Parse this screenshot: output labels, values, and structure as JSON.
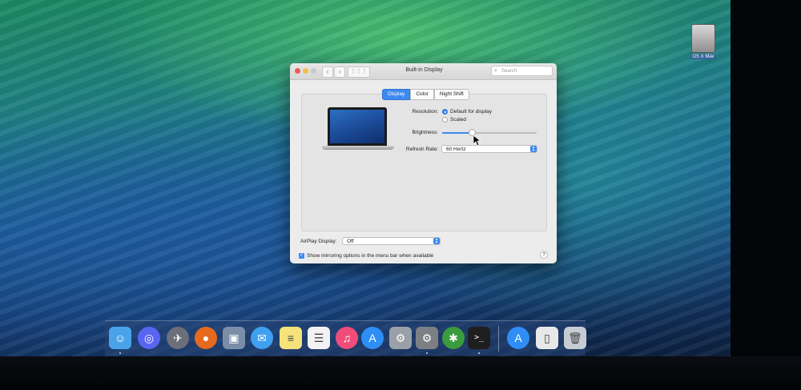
{
  "window": {
    "title": "Built-in Display",
    "search_placeholder": "Search",
    "back_glyph": "‹",
    "forward_glyph": "›",
    "show_all_glyph": "⋮⋮⋮"
  },
  "tabs": [
    {
      "label": "Display",
      "active": true
    },
    {
      "label": "Color",
      "active": false
    },
    {
      "label": "Night Shift",
      "active": false
    }
  ],
  "display": {
    "resolution_label": "Resolution:",
    "resolution_options": [
      {
        "label": "Default for display",
        "selected": true
      },
      {
        "label": "Scaled",
        "selected": false
      }
    ],
    "brightness_label": "Brightness:",
    "brightness_value": 0.32,
    "refresh_rate_label": "Refresh Rate:",
    "refresh_rate_value": "60 Hertz"
  },
  "airplay": {
    "label": "AirPlay Display:",
    "value": "Off"
  },
  "mirroring": {
    "label": "Show mirroring options in the menu bar when available",
    "checked": true
  },
  "help_glyph": "?",
  "desktop_drive": {
    "label": "OS X Mav",
    "icon": "hard-drive-icon"
  },
  "colors": {
    "accent": "#3d8af0",
    "close": "#ee5e56",
    "minimize": "#f3be4f",
    "zoom": "#c9c9c9"
  },
  "dock": [
    {
      "name": "finder-icon",
      "glyph": "☺",
      "bg": "#4aa3e8",
      "running": true
    },
    {
      "name": "discord-icon",
      "glyph": "◎",
      "bg": "#5865f2",
      "running": false
    },
    {
      "name": "launchpad-icon",
      "glyph": "✈",
      "bg": "#6c6f7a",
      "running": false
    },
    {
      "name": "firefox-icon",
      "glyph": "●",
      "bg": "#e66a1e",
      "running": false
    },
    {
      "name": "preview-icon",
      "glyph": "▣",
      "bg": "#7b8ea8",
      "running": false
    },
    {
      "name": "messages-icon",
      "glyph": "✉",
      "bg": "#3fa0ef",
      "running": false
    },
    {
      "name": "notes-icon",
      "glyph": "≡",
      "bg": "#f6e27a",
      "running": false
    },
    {
      "name": "reminders-icon",
      "glyph": "☰",
      "bg": "#f2f2f2",
      "running": false
    },
    {
      "name": "itunes-icon",
      "glyph": "♫",
      "bg": "#f04c7a",
      "running": false
    },
    {
      "name": "app-store-icon",
      "glyph": "A",
      "bg": "#2f8ef5",
      "running": false
    },
    {
      "name": "disk-utility-icon",
      "glyph": "⚙",
      "bg": "#9aa0a8",
      "running": false
    },
    {
      "name": "system-preferences-icon",
      "glyph": "⚙",
      "bg": "#7d7f84",
      "running": true
    },
    {
      "name": "compass-icon",
      "glyph": "✱",
      "bg": "#3a9c3c",
      "running": false
    },
    {
      "name": "terminal-icon",
      "glyph": ">_",
      "bg": "#1e1e1e",
      "running": true
    },
    {
      "name": "app-store-folder-icon",
      "glyph": "A",
      "bg": "#2f8ef5",
      "running": false
    },
    {
      "name": "document-icon",
      "glyph": "▯",
      "bg": "#e8e8e8",
      "running": false
    },
    {
      "name": "trash-icon",
      "glyph": "🗑",
      "bg": "#c6ccd4",
      "running": false
    }
  ]
}
